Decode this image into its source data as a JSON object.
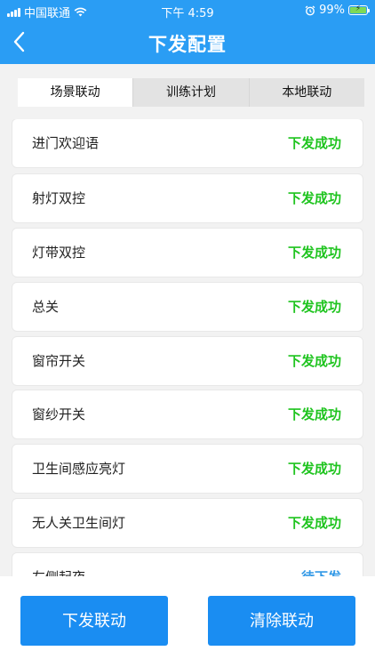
{
  "status_bar": {
    "carrier": "中国联通",
    "time": "下午 4:59",
    "battery_percent": "99%",
    "battery_level": 0.99
  },
  "header": {
    "title": "下发配置"
  },
  "tabs": [
    {
      "label": "场景联动",
      "active": true
    },
    {
      "label": "训练计划",
      "active": false
    },
    {
      "label": "本地联动",
      "active": false
    }
  ],
  "items": [
    {
      "name": "进门欢迎语",
      "status": "下发成功"
    },
    {
      "name": "射灯双控",
      "status": "下发成功"
    },
    {
      "name": "灯带双控",
      "status": "下发成功"
    },
    {
      "name": "总关",
      "status": "下发成功"
    },
    {
      "name": "窗帘开关",
      "status": "下发成功"
    },
    {
      "name": "窗纱开关",
      "status": "下发成功"
    },
    {
      "name": "卫生间感应亮灯",
      "status": "下发成功"
    },
    {
      "name": "无人关卫生间灯",
      "status": "下发成功"
    },
    {
      "name": "左侧起夜",
      "status": "待下发"
    }
  ],
  "colors": {
    "header_bg": "#2a9df4",
    "status_success": "#1fc41f",
    "status_pending": "#3399e6",
    "button_bg": "#1a8df2"
  },
  "footer": {
    "send_button": "下发联动",
    "clear_button": "清除联动"
  }
}
